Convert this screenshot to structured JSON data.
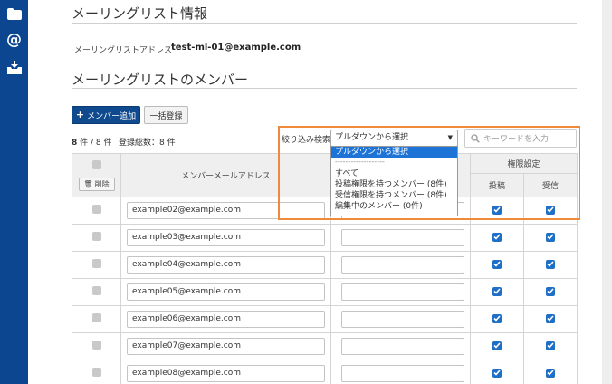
{
  "sections": {
    "info_title": "メーリングリスト情報",
    "members_title": "メーリングリストのメンバー"
  },
  "info": {
    "address_label": "メーリングリストアドレス",
    "address_value": "test-ml-01@example.com"
  },
  "toolbar": {
    "add_member_label": "メンバー追加",
    "bulk_register_label": "一括登録"
  },
  "counts": {
    "shown": "8",
    "sep": "件 /",
    "total_shown": "8",
    "unit": "件",
    "registered_total": "登録総数：8 件"
  },
  "filter": {
    "label": "絞り込み検索",
    "selected": "プルダウンから選択",
    "options": [
      "プルダウンから選択",
      "-------------------",
      "すべて",
      "投稿権限を持つメンバー (8件)",
      "受信権限を持つメンバー (8件)",
      "編集中のメンバー (0件)"
    ],
    "keyword_placeholder": "キーワードを入力"
  },
  "table": {
    "delete_label": "削除",
    "col_address": "メンバーメールアドレス",
    "col_permission": "権限設定",
    "col_post": "投稿",
    "col_receive": "受信",
    "rows": [
      {
        "email": "example02@example.com",
        "name": "",
        "post": true,
        "receive": true
      },
      {
        "email": "example03@example.com",
        "name": "",
        "post": true,
        "receive": true
      },
      {
        "email": "example04@example.com",
        "name": "",
        "post": true,
        "receive": true
      },
      {
        "email": "example05@example.com",
        "name": "",
        "post": true,
        "receive": true
      },
      {
        "email": "example06@example.com",
        "name": "",
        "post": true,
        "receive": true
      },
      {
        "email": "example07@example.com",
        "name": "",
        "post": true,
        "receive": true
      },
      {
        "email": "example08@example.com",
        "name": "",
        "post": true,
        "receive": true
      }
    ]
  },
  "colors": {
    "sidebar": "#0c4690",
    "primary_button": "#0f4a8e",
    "highlight_border": "#ef8a3d",
    "checkbox_blue": "#1f6fc6",
    "selected_option": "#1e74d6"
  },
  "icons": {
    "sidebar": [
      "folder-icon",
      "at-sign-icon",
      "inbox-download-icon"
    ],
    "search": "magnifier-icon",
    "trash": "trash-icon"
  }
}
